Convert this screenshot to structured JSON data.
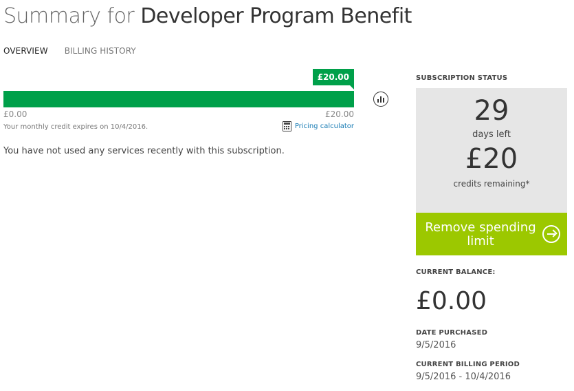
{
  "header": {
    "title_prefix": "Summary for",
    "title_name": "Developer Program Benefit"
  },
  "tabs": [
    {
      "label": "OVERVIEW",
      "active": true
    },
    {
      "label": "BILLING HISTORY",
      "active": false
    }
  ],
  "usage": {
    "callout_value": "£20.00",
    "fill_fraction": 1.0,
    "scale_min": "£0.00",
    "scale_max": "£20.00",
    "expiry_text": "Your monthly credit expires on 10/4/2016.",
    "pricing_link": "Pricing calculator",
    "accent_color": "#00a04a"
  },
  "main": {
    "empty_message": "You have not used any services recently with this subscription."
  },
  "status": {
    "label": "SUBSCRIPTION STATUS",
    "days_value": "29",
    "days_label": "days left",
    "credits_value": "£20",
    "credits_label": "credits remaining*",
    "action_label": "Remove spending limit",
    "action_color": "#9cc800"
  },
  "balance": {
    "label": "CURRENT BALANCE:",
    "value": "£0.00"
  },
  "purchase": {
    "label": "DATE PURCHASED",
    "value": "9/5/2016"
  },
  "billing_period": {
    "label": "CURRENT BILLING PERIOD",
    "value": "9/5/2016 - 10/4/2016"
  }
}
